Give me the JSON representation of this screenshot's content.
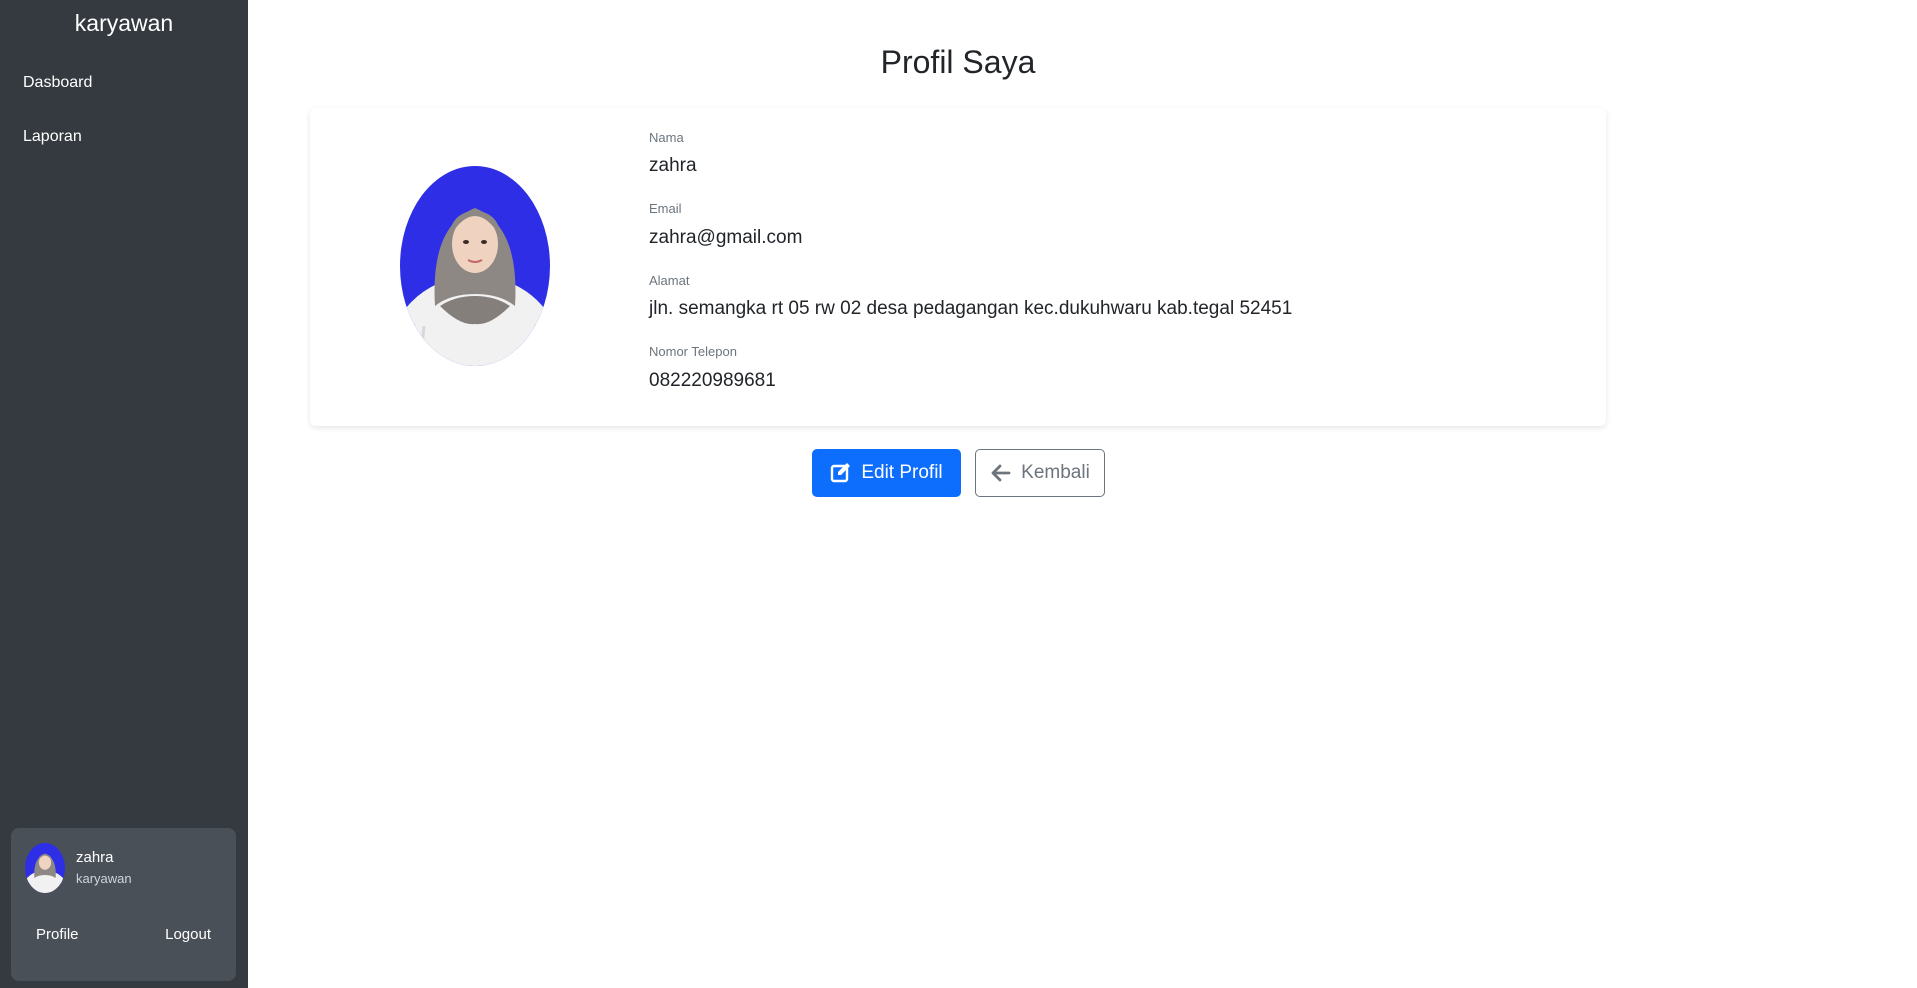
{
  "sidebar": {
    "brand": "karyawan",
    "items": [
      {
        "label": "Dasboard"
      },
      {
        "label": "Laporan"
      }
    ],
    "user": {
      "name": "zahra",
      "role": "karyawan",
      "profile_label": "Profile",
      "logout_label": "Logout"
    }
  },
  "main": {
    "title": "Profil Saya",
    "fields": {
      "nama": {
        "label": "Nama",
        "value": "zahra"
      },
      "email": {
        "label": "Email",
        "value": "zahra@gmail.com"
      },
      "alamat": {
        "label": "Alamat",
        "value": "jln. semangka rt 05 rw 02 desa pedagangan kec.dukuhwaru kab.tegal 52451"
      },
      "telepon": {
        "label": "Nomor Telepon",
        "value": "082220989681"
      }
    },
    "buttons": {
      "edit_label": "Edit Profil",
      "edit_icon": "edit-icon",
      "back_label": "Kembali",
      "back_icon": "arrow-left-icon"
    }
  },
  "colors": {
    "sidebar_bg": "#343a40",
    "user_card_bg": "#495057",
    "primary": "#0d6efd",
    "secondary": "#6c757d",
    "photo_bg": "#2e2ee6"
  }
}
